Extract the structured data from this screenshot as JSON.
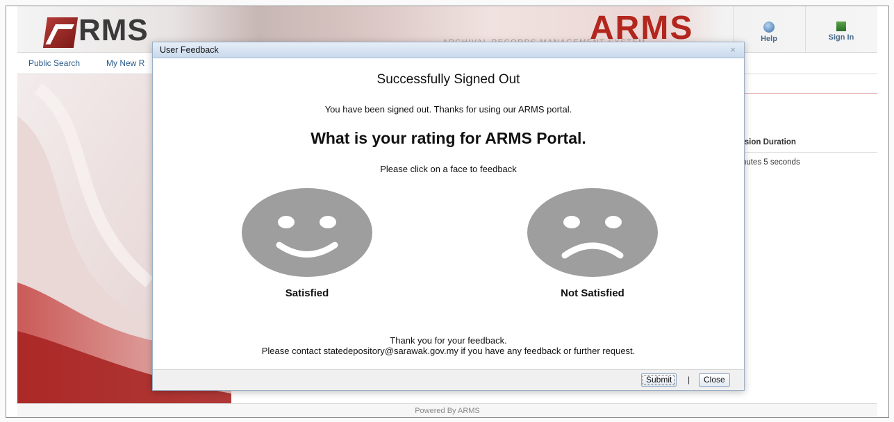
{
  "header": {
    "logo_text": "RMS",
    "brand": "ARMS",
    "brand_sub": "ARCHIVAL RECORDS MANAGEMENT SYSTEM",
    "help_label": "Help",
    "signin_label": "Sign In"
  },
  "nav": {
    "public_search": "Public Search",
    "my_new": "My New R"
  },
  "session": {
    "heading": "ession Duration",
    "value": "ninutes 5 seconds"
  },
  "footer": {
    "text": "Powered By ARMS"
  },
  "dialog": {
    "title": "User Feedback",
    "close_glyph": "×",
    "heading": "Successfully Signed Out",
    "signed_out_msg": "You have been signed out. Thanks for using our ARMS portal.",
    "rating_question": "What is your rating for ARMS Portal.",
    "instruction": "Please click on a face to feedback",
    "faces": [
      {
        "label": "Satisfied",
        "icon": "smiley-face-icon"
      },
      {
        "label": "Not Satisfied",
        "icon": "sad-face-icon"
      }
    ],
    "thanks_line1": "Thank you for your feedback.",
    "thanks_line2": "Please contact statedepository@sarawak.gov.my if you have any feedback or further request.",
    "submit_label": "Submit",
    "separator": "|",
    "close_label": "Close"
  },
  "colors": {
    "brand_red": "#b3261e",
    "face_gray": "#9e9e9e",
    "link_blue": "#2a5a8a"
  }
}
